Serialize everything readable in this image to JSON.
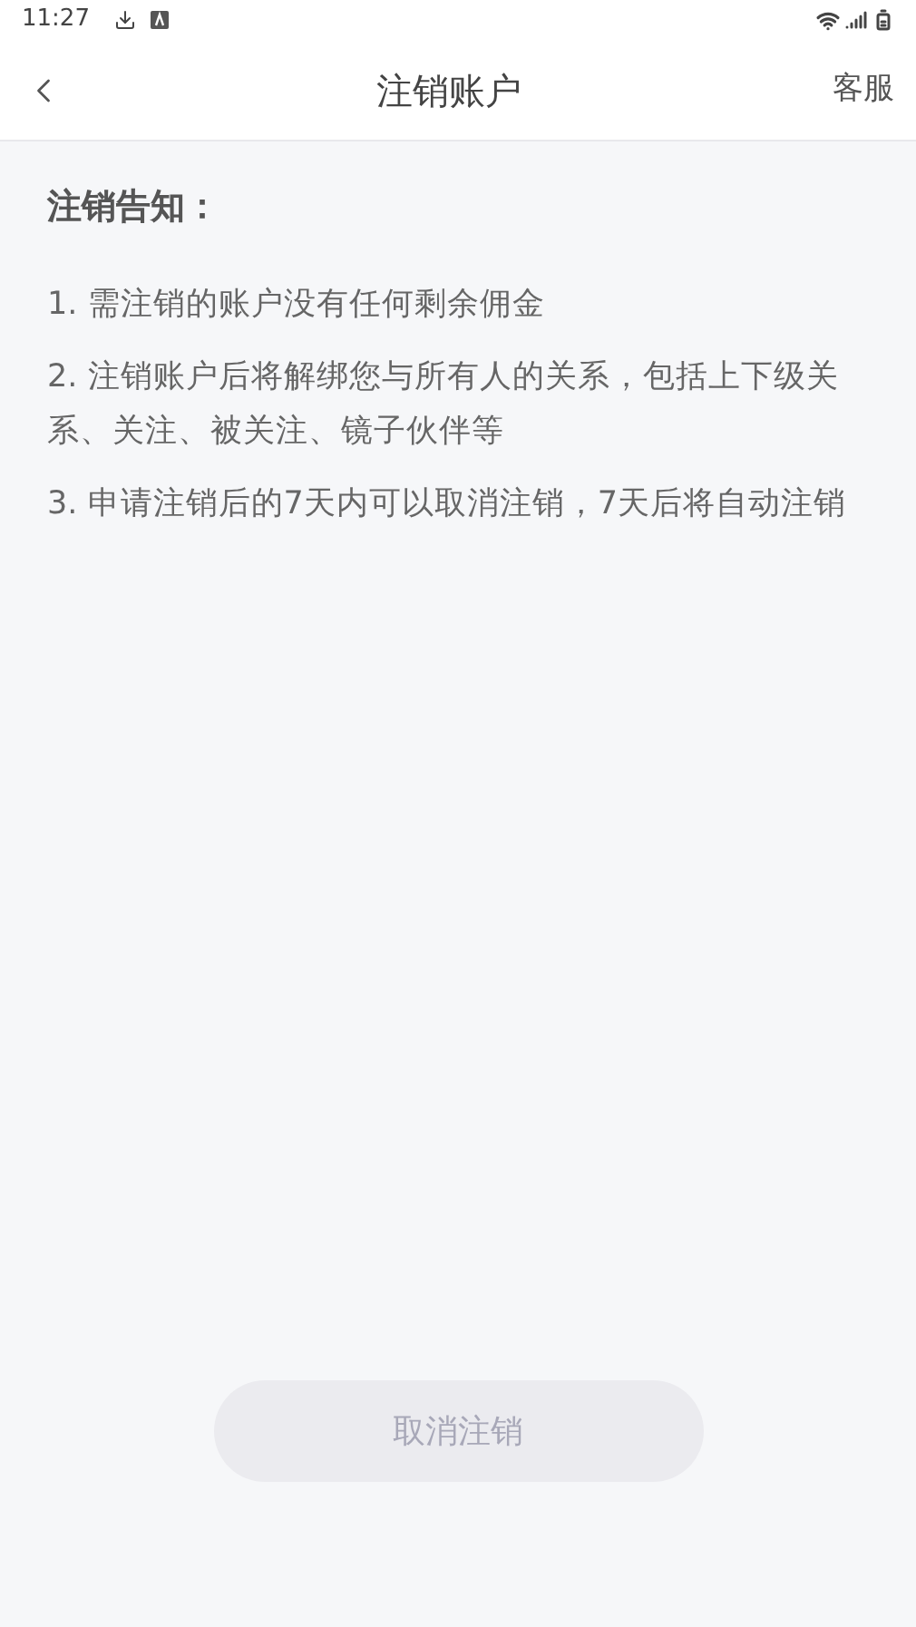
{
  "status_bar": {
    "time": "11:27"
  },
  "header": {
    "title": "注销账户",
    "action": "客服"
  },
  "notice": {
    "title": "注销告知：",
    "items": [
      "1. 需注销的账户没有任何剩余佣金",
      "2. 注销账户后将解绑您与所有人的关系，包括上下级关系、关注、被关注、镜子伙伴等",
      "3. 申请注销后的7天内可以取消注销，7天后将自动注销"
    ]
  },
  "button": {
    "label": "取消注销",
    "disabled": true
  }
}
